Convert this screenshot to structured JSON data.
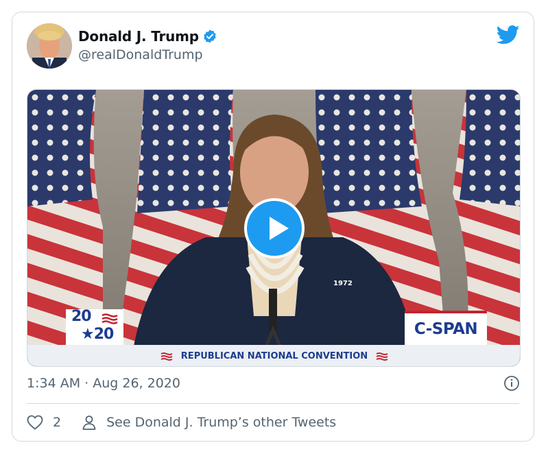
{
  "tweet": {
    "display_name": "Donald J. Trump",
    "handle": "@realDonaldTrump",
    "timestamp": "1:34 AM · Aug 26, 2020",
    "like_count": "2",
    "other_tweets_label": "See Donald J. Trump’s other Tweets"
  },
  "media": {
    "rnc_logo_top": "20",
    "rnc_logo_bottom": "★20",
    "pin_text": "1972",
    "network_logo": "C-SPAN",
    "lower_third": "REPUBLICAN NATIONAL CONVENTION"
  },
  "icons": {
    "verified": "verified-badge-icon",
    "brand": "twitter-bird-icon",
    "play": "play-icon",
    "info": "info-icon",
    "like": "heart-icon",
    "profile": "person-icon"
  },
  "colors": {
    "accent": "#1d9bf0",
    "text_primary": "#0f1419",
    "text_secondary": "#536471",
    "border": "#cfd9de"
  }
}
